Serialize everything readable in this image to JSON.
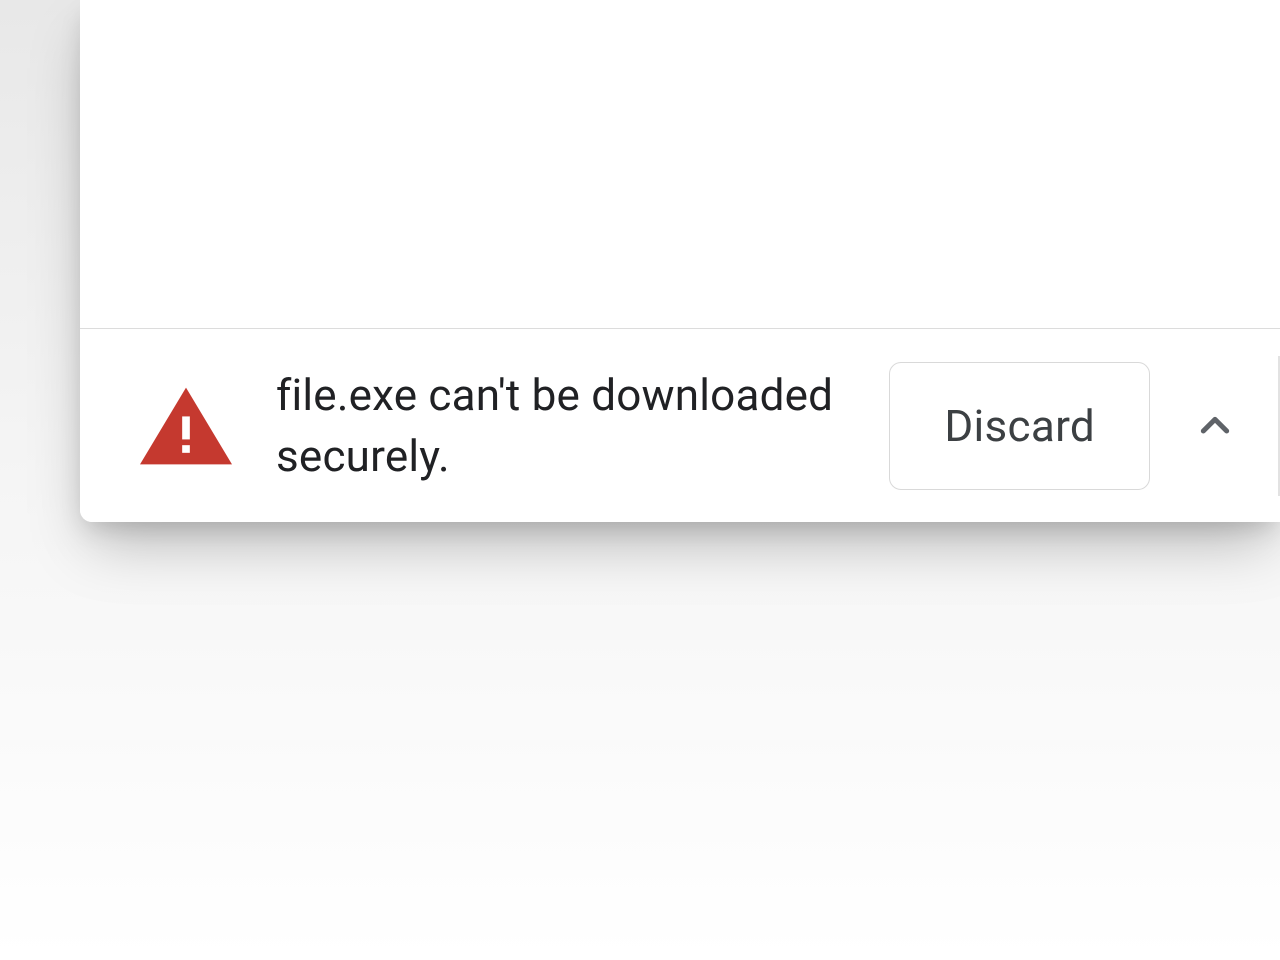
{
  "download_bar": {
    "warning_message": "file.exe can't be downloaded securely.",
    "discard_label": "Discard",
    "icon_color": "#c5392f",
    "chevron_color": "#5f6368"
  }
}
